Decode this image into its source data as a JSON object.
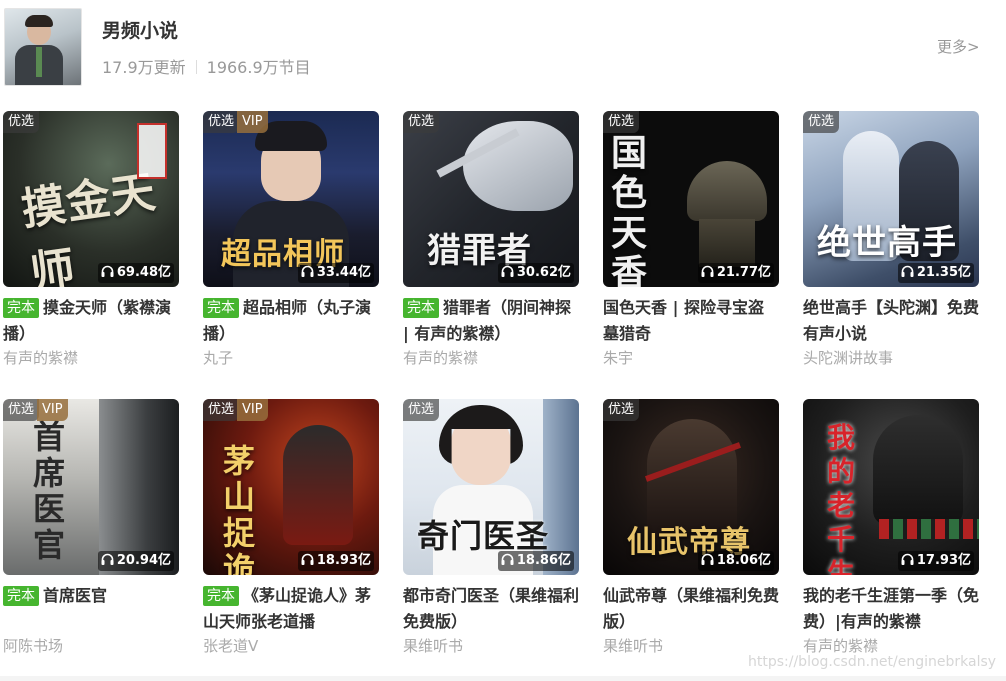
{
  "header": {
    "title": "男频小说",
    "updates": "17.9万更新",
    "programs": "1966.9万节目",
    "more": "更多>"
  },
  "badges": {
    "youxuan": "优选",
    "vip": "VIP",
    "wanben": "完本"
  },
  "cards": [
    {
      "title": "摸金天师（紫襟演播）",
      "author": "有声的紫襟",
      "plays": "69.48亿",
      "finished": true,
      "vip": false,
      "cover_text": "摸金天师"
    },
    {
      "title": "超品相师（丸子演播）",
      "author": "丸子",
      "plays": "33.44亿",
      "finished": true,
      "vip": true,
      "cover_text": "超品相师"
    },
    {
      "title": "猎罪者（阴间神探 | 有声的紫襟）",
      "author": "有声的紫襟",
      "plays": "30.62亿",
      "finished": true,
      "vip": false,
      "cover_text": "猎罪者"
    },
    {
      "title": "国色天香 | 探险寻宝盗墓猎奇",
      "author": "朱宇",
      "plays": "21.77亿",
      "finished": false,
      "vip": false,
      "cover_text": "国色天香"
    },
    {
      "title": "绝世高手【头陀渊】免费有声小说",
      "author": "头陀渊讲故事",
      "plays": "21.35亿",
      "finished": false,
      "vip": false,
      "cover_text": "绝世高手"
    },
    {
      "title": "首席医官",
      "author": "阿陈书场",
      "plays": "20.94亿",
      "finished": true,
      "vip": true,
      "cover_text": "首席医官"
    },
    {
      "title": "《茅山捉诡人》茅山天师张老道播",
      "author": "张老道V",
      "plays": "18.93亿",
      "finished": true,
      "vip": true,
      "cover_text": "茅山捉诡人"
    },
    {
      "title": "都市奇门医圣（果维福利免费版）",
      "author": "果维听书",
      "plays": "18.86亿",
      "finished": false,
      "vip": false,
      "cover_text": "奇门医圣"
    },
    {
      "title": "仙武帝尊（果维福利免费版）",
      "author": "果维听书",
      "plays": "18.06亿",
      "finished": false,
      "vip": false,
      "cover_text": "仙武帝尊"
    },
    {
      "title": "我的老千生涯第一季（免费）|有声的紫襟",
      "author": "有声的紫襟",
      "plays": "17.93亿",
      "finished": false,
      "vip": false,
      "cover_text": "我的老千生涯"
    }
  ],
  "watermark": "https://blog.csdn.net/enginebrkalsy"
}
